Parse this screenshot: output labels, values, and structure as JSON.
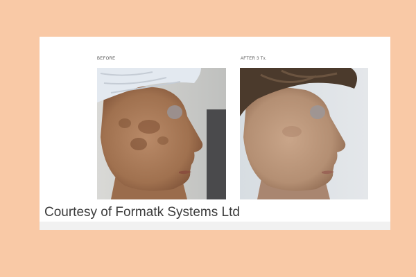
{
  "panels": {
    "before": {
      "label": "BEFORE"
    },
    "after": {
      "label": "AFTER 3 Tx."
    }
  },
  "caption": "Courtesy of Formatk Systems Ltd",
  "colors": {
    "page_background": "#f9c9a6",
    "card_background": "#ffffff",
    "caption_text": "#3b3b3b"
  }
}
